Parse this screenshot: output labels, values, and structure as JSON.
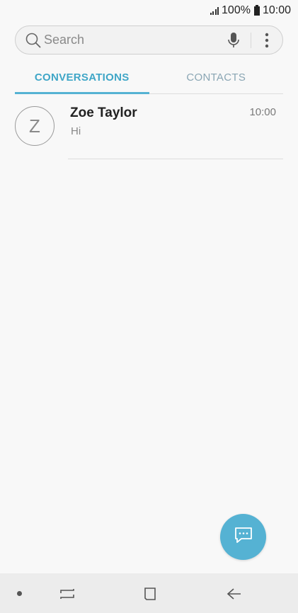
{
  "status_bar": {
    "battery": "100%",
    "time": "10:00"
  },
  "search": {
    "placeholder": "Search"
  },
  "tabs": [
    {
      "label": "CONVERSATIONS",
      "active": true
    },
    {
      "label": "CONTACTS",
      "active": false
    }
  ],
  "conversations": [
    {
      "initial": "Z",
      "name": "Zoe Taylor",
      "preview": "Hi",
      "time": "10:00"
    }
  ],
  "icons": {
    "search": "search-icon",
    "mic": "microphone-icon",
    "more": "more-vertical-icon",
    "compose": "compose-message-icon",
    "recents": "recent-apps-icon",
    "home": "home-icon",
    "back": "back-icon"
  },
  "colors": {
    "accent": "#55b2d3",
    "active_tab_text": "#3fa6c7",
    "inactive_tab_text": "#8aa6b4",
    "background": "#f8f8f8"
  }
}
